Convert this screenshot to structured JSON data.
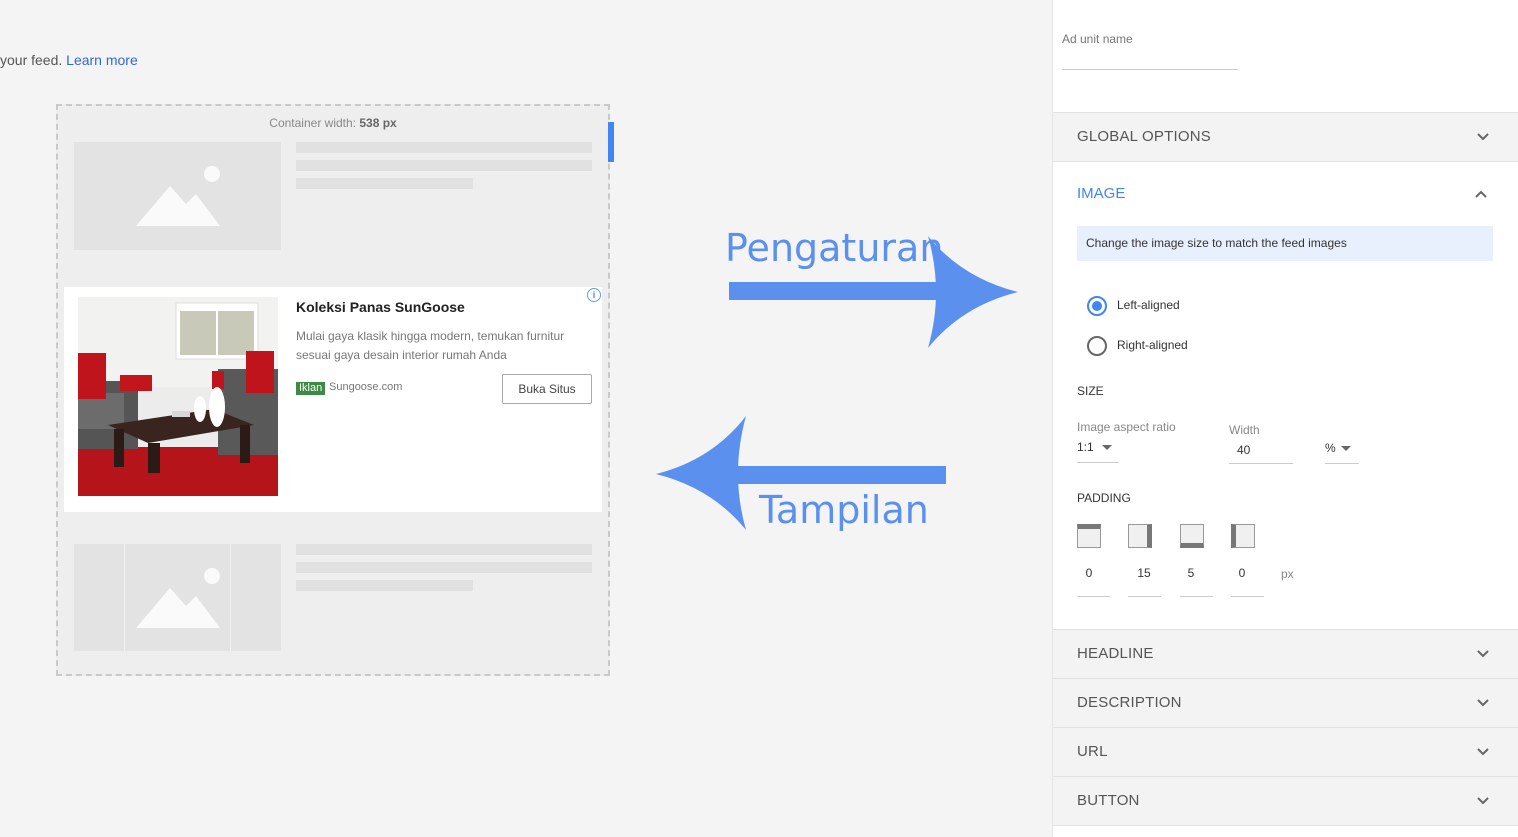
{
  "intro": {
    "text": "your feed.",
    "link": "Learn more"
  },
  "preview": {
    "container_label": "Container width:",
    "container_value": "538 px",
    "ad": {
      "title": "Koleksi Panas SunGoose",
      "description": "Mulai gaya klasik hingga modern, temukan furnitur sesuai gaya desain interior rumah Anda",
      "badge": "Iklan",
      "url": "Sungoose.com",
      "button": "Buka Situs"
    }
  },
  "annotations": {
    "settings": "Pengaturan",
    "display": "Tampilan",
    "arrow_color": "#5b90ef"
  },
  "panel": {
    "ad_unit_name_label": "Ad unit name",
    "sections_top": [
      {
        "label": "GLOBAL OPTIONS"
      }
    ],
    "image": {
      "title": "IMAGE",
      "info": "Change the image size to match the feed images",
      "alignment": [
        {
          "label": "Left-aligned",
          "selected": true
        },
        {
          "label": "Right-aligned",
          "selected": false
        }
      ],
      "size_heading": "SIZE",
      "aspect_label": "Image aspect ratio",
      "aspect_value": "1:1",
      "width_label": "Width",
      "width_value": "40",
      "unit_value": "%",
      "padding_heading": "PADDING",
      "padding_values": [
        "0",
        "15",
        "5",
        "0"
      ],
      "padding_unit": "px"
    },
    "sections_bottom": [
      {
        "label": "HEADLINE"
      },
      {
        "label": "DESCRIPTION"
      },
      {
        "label": "URL"
      },
      {
        "label": "BUTTON"
      }
    ]
  },
  "colors": {
    "accent": "#4285f4",
    "info_bg": "#e8f0fe",
    "badge": "#3c8a44"
  }
}
